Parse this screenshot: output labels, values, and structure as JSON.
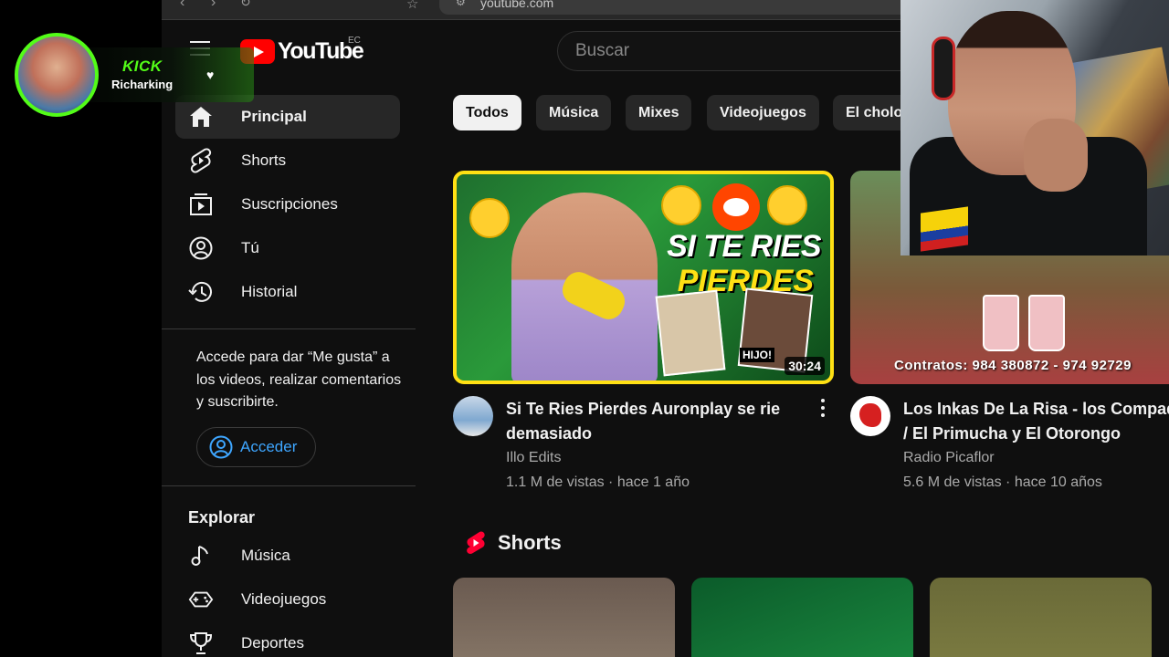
{
  "browser": {
    "url": "youtube.com"
  },
  "header": {
    "logo_text": "YouTube",
    "country_code": "EC",
    "search_placeholder": "Buscar"
  },
  "sidebar": {
    "items": [
      {
        "label": "Principal",
        "icon": "home-icon",
        "active": true
      },
      {
        "label": "Shorts",
        "icon": "shorts-icon"
      },
      {
        "label": "Suscripciones",
        "icon": "subscriptions-icon"
      },
      {
        "label": "Tú",
        "icon": "user-circle-icon"
      },
      {
        "label": "Historial",
        "icon": "history-icon"
      }
    ],
    "signin_text": "Accede para dar “Me gusta” a los videos, realizar comentarios y suscribirte.",
    "signin_button": "Acceder",
    "explore_title": "Explorar",
    "explore_items": [
      {
        "label": "Música",
        "icon": "music-note-icon"
      },
      {
        "label": "Videojuegos",
        "icon": "gamepad-icon"
      },
      {
        "label": "Deportes",
        "icon": "trophy-icon"
      }
    ]
  },
  "chips": [
    "Todos",
    "Música",
    "Mixes",
    "Videojuegos",
    "El cholo"
  ],
  "videos": [
    {
      "title_line1": "Si Te Ries Pierdes Auronplay se rie",
      "title_line2": "demasiado",
      "channel": "Illo Edits",
      "meta": "1.1 M de vistas · hace 1 año",
      "duration": "30:24",
      "thumb_text_1": "SI TE RIES",
      "thumb_text_2": "PIERDES",
      "thumb_tag": "HIJO!"
    },
    {
      "title_line1": "Los Inkas De La Risa - los Compad",
      "title_line2": "/ El Primucha y El Otorongo",
      "channel": "Radio Picaflor",
      "meta": "5.6 M de vistas · hace 10 años",
      "thumb_watermark": "Contratos: 984 380872 - 974 92729"
    }
  ],
  "shorts_section": {
    "title": "Shorts"
  },
  "overlay": {
    "brand": "KICK",
    "username": "Richarking",
    "accent_color": "#53fc18"
  },
  "colors": {
    "background": "#0f0f0f",
    "youtube_red": "#ff0000",
    "link_blue": "#3ea6ff",
    "thumb_border": "#ffe014"
  }
}
